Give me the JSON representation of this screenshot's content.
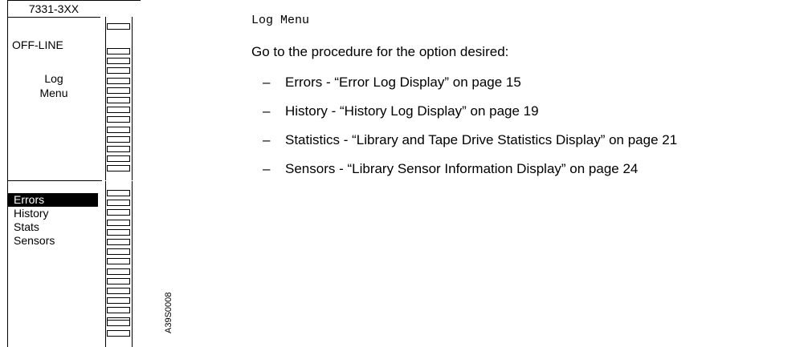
{
  "panel": {
    "model": "7331-3XX",
    "status": "OFF-LINE",
    "menu_title_line1": "Log",
    "menu_title_line2": "Menu",
    "menu_items": [
      "Errors",
      "History",
      "Stats",
      "Sensors"
    ],
    "selected_item": "Errors",
    "figure_id": "A39S0008"
  },
  "content": {
    "heading": "Log Menu",
    "intro": "Go to the procedure for the option desired:",
    "dash": "–",
    "options": [
      "Errors - “Error Log Display” on page 15",
      "History - “History Log Display” on page 19",
      "Statistics - “Library and Tape Drive Statistics Display” on page 21",
      "Sensors - “Library Sensor Information Display” on page 24"
    ]
  }
}
